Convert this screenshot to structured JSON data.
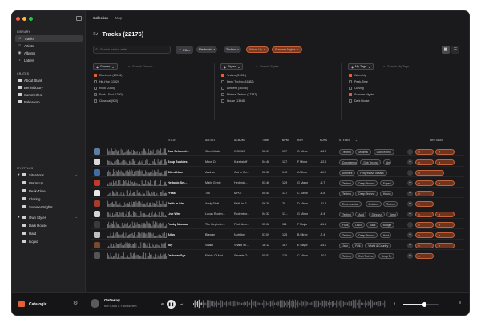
{
  "window": {
    "traffic_lights": [
      "#ff5f57",
      "#febc2e",
      "#28c840"
    ]
  },
  "sidebar": {
    "library_header": "LIBRARY",
    "library": [
      {
        "label": "Tracks",
        "icon": "music-note-icon",
        "active": true
      },
      {
        "label": "Artists",
        "icon": "person-icon"
      },
      {
        "label": "Albums",
        "icon": "disc-icon"
      },
      {
        "label": "Labels",
        "icon": "tag-icon"
      }
    ],
    "crates_header": "CRATES",
    "crates": [
      "About Blank",
      "Berlinidustry",
      "Summerfest",
      "Bakeroom"
    ],
    "mystyles_header": "MYSTYLES",
    "situations": {
      "label": "Situations",
      "items": [
        "Warm Up",
        "Peak-Time",
        "Closing",
        "Summer Nights"
      ]
    },
    "own_styles": {
      "label": "Own Styles",
      "items": [
        "Dark House",
        "Hard",
        "Liquid"
      ]
    },
    "brand": "Catalogic"
  },
  "main": {
    "tabs": [
      "Collection",
      "Map"
    ],
    "title": "Tracks (22176)",
    "search_placeholder": "Search tracks, artist...",
    "filter_label": "Filter",
    "chips": [
      {
        "label": "Electronic",
        "style": "gray"
      },
      {
        "label": "Techno",
        "style": "gray"
      },
      {
        "label": "Warm-Up",
        "style": "orange"
      },
      {
        "label": "Summer Nights",
        "style": "orange"
      }
    ],
    "panels": [
      {
        "dropdown": "Genres",
        "search": "Search Genres",
        "options": [
          {
            "label": "Electronic (19943)",
            "state": "on"
          },
          {
            "label": "Hip-Hop (1352)",
            "state": "off"
          },
          {
            "label": "Rock (2365)",
            "state": "off"
          },
          {
            "label": "Funk / Soul (1340)",
            "state": "off"
          },
          {
            "label": "Classical (920)",
            "state": "off"
          }
        ]
      },
      {
        "dropdown": "Styles",
        "search": "Search Styles",
        "options": [
          {
            "label": "Techno (24034)",
            "state": "on"
          },
          {
            "label": "Deep Techno (16382)",
            "state": "off"
          },
          {
            "label": "Ambient (16048)",
            "state": "off"
          },
          {
            "label": "Minimal Techno (17387)",
            "state": "off"
          },
          {
            "label": "House (13948)",
            "state": "off"
          }
        ]
      },
      {
        "dropdown": "My Tags",
        "search": "Search My Tags",
        "options": [
          {
            "label": "Warm-Up",
            "state": "on"
          },
          {
            "label": "Peak-Time",
            "state": "off"
          },
          {
            "label": "Closing",
            "state": "off"
          },
          {
            "label": "Summer Nights",
            "state": "on"
          },
          {
            "label": "Dark House",
            "state": "off"
          }
        ]
      }
    ],
    "columns": {
      "title": "TITLE",
      "artist": "ARTIST",
      "album": "ALBUM",
      "time": "TIME",
      "bpm": "BPM",
      "key": "KEY",
      "lufs": "LUFS",
      "styles": "STYLES",
      "mytags": "MY TAGS"
    },
    "rows": [
      {
        "title": "Dub Schmeid...",
        "artist": "Skee Mask",
        "album": "ISSON3",
        "time": "06:07",
        "bpm": "137",
        "key": "C Minor",
        "lufs": "-10.3",
        "styles": [
          "Techno",
          "Minimal",
          "Dub Techno"
        ],
        "tags": [
          "Warm-Up",
          "Summer Ni"
        ],
        "art": "#5b7fa3"
      },
      {
        "title": "Soap Bubbles",
        "artist": "Move D",
        "album": "Kunststoff",
        "time": "04:46",
        "bpm": "127",
        "key": "F Minor",
        "lufs": "-12.6",
        "styles": [
          "Downtempo",
          "Dub Techno",
          "Am"
        ],
        "tags": [
          "Warm-Up",
          "Summer Ni"
        ],
        "art": "#d9d9d9"
      },
      {
        "title": "Silent Now",
        "artist": "Andras",
        "album": "Out in Ca...",
        "time": "06:32",
        "bpm": "143",
        "key": "A Minor",
        "lufs": "-11.2",
        "styles": [
          "Ambient",
          "Progressive Breaks"
        ],
        "tags": [
          "Summer Nights"
        ],
        "art": "#3e6ea3"
      },
      {
        "title": "Hedonic Set...",
        "artist": "Malin Genie",
        "album": "Hedonic...",
        "time": "03:46",
        "bpm": "129",
        "key": "G Major",
        "lufs": "-6.7",
        "styles": [
          "Techno",
          "Deep Techno",
          "Experi"
        ],
        "tags": [
          "Warm-Up",
          "Summer Ni"
        ],
        "art": "#c0392b"
      },
      {
        "title": "Freak",
        "artist": "Tilo",
        "album": "MP07",
        "time": "05:45",
        "bpm": "137",
        "key": "C Minor",
        "lufs": "-8.5",
        "styles": [
          "Techno",
          "Deep Techno",
          "House"
        ],
        "tags": [
          "Warm-Up"
        ],
        "art": "#e8e8e8"
      },
      {
        "title": "Faith in Stra...",
        "artist": "Andy Stott",
        "album": "Faith in S...",
        "time": "06:20",
        "bpm": "78",
        "key": "D Minor",
        "lufs": "-11.2",
        "styles": [
          "Experimental",
          "Ambient",
          "Techno"
        ],
        "tags": [
          "Warm-Up"
        ],
        "art": "#a83a2e"
      },
      {
        "title": "Live Wire",
        "artist": "Lucas Roden...",
        "album": "Rodenbur...",
        "time": "04:32",
        "bpm": "13...",
        "key": "G Minor",
        "lufs": "-9.4",
        "styles": [
          "Techno",
          "Acid",
          "Schranz",
          "Deep"
        ],
        "tags": [
          "Warm-Up",
          "Summer Ni"
        ],
        "art": "#d4d4d4"
      },
      {
        "title": "Funky Nassau",
        "artist": "The Beginnin...",
        "album": "Frick Ana...",
        "time": "03:08",
        "bpm": "111",
        "key": "F Major",
        "lufs": "-11.5",
        "styles": [
          "Funk",
          "Disco",
          "Jazz",
          "Boogie"
        ],
        "tags": [
          "Warm-Up",
          "Summer Ni"
        ],
        "art": "#3a3a3a"
      },
      {
        "title": "Atlas",
        "artist": "Blawan",
        "album": "Nutrition",
        "time": "07:09",
        "bpm": "125",
        "key": "B Minor",
        "lufs": "-7.4",
        "styles": [
          "Techno",
          "Deep Techno",
          "Hard"
        ],
        "tags": [
          "Warm-Up",
          "Summer Ni"
        ],
        "art": "#bfbfbf"
      },
      {
        "title": "Joy",
        "artist": "Shakti",
        "album": "Shakti wi...",
        "time": "18:12",
        "bpm": "167",
        "key": "E Major",
        "lufs": "-14.2",
        "styles": [
          "Jazz",
          "Folk",
          "World & Country"
        ],
        "tags": [
          "Warm-Up",
          "Summer Ni"
        ],
        "art": "#7a4a2a"
      },
      {
        "title": "Darkstar Sys...",
        "artist": "Fields Of Mot",
        "album": "Secrets O...",
        "time": "05:52",
        "bpm": "135",
        "key": "C Minor",
        "lufs": "-10.2",
        "styles": [
          "Techno",
          "Dub Techno",
          "Deep Te"
        ],
        "tags": [
          "Warm-Up"
        ],
        "art": "#555555"
      }
    ]
  },
  "player": {
    "title": "Gateway",
    "artist": "Ben Klock & Fadi Mohem",
    "progress": 0.05,
    "volume": 0.6
  }
}
